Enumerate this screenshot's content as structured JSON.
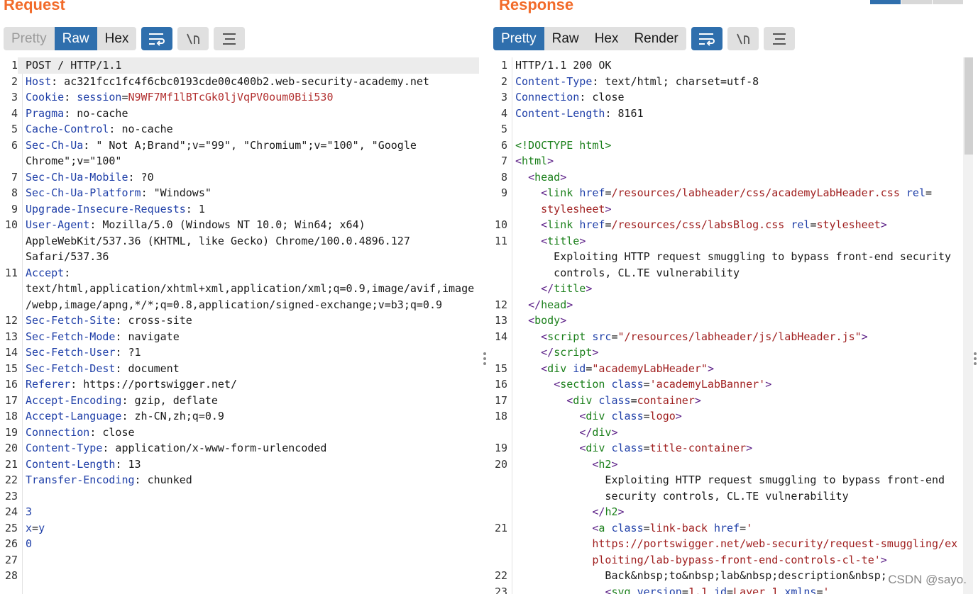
{
  "request": {
    "title": "Request",
    "tabs": [
      "Pretty",
      "Raw",
      "Hex"
    ],
    "active_tab": "Raw",
    "lines": [
      {
        "n": "1",
        "parts": [
          [
            "v",
            "POST / HTTP/1.1"
          ]
        ]
      },
      {
        "n": "2",
        "parts": [
          [
            "k",
            "Host"
          ],
          [
            "v",
            ": ac321fcc1fc4f6cbc0193cde00c400b2.web-security-academy.net"
          ]
        ]
      },
      {
        "n": "3",
        "parts": [
          [
            "k",
            "Cookie"
          ],
          [
            "v",
            ": "
          ],
          [
            "blu",
            "session"
          ],
          [
            "v",
            "="
          ],
          [
            "red",
            "N9WF7Mf1lBTcGk0ljVqPV0oum0Bii530"
          ]
        ]
      },
      {
        "n": "4",
        "parts": [
          [
            "k",
            "Pragma"
          ],
          [
            "v",
            ": no-cache"
          ]
        ]
      },
      {
        "n": "5",
        "parts": [
          [
            "k",
            "Cache-Control"
          ],
          [
            "v",
            ": no-cache"
          ]
        ]
      },
      {
        "n": "6",
        "parts": [
          [
            "k",
            "Sec-Ch-Ua"
          ],
          [
            "v",
            ": \" Not A;Brand\";v=\"99\", \"Chromium\";v=\"100\", \"Google"
          ]
        ]
      },
      {
        "n": "",
        "parts": [
          [
            "v",
            "Chrome\";v=\"100\""
          ]
        ]
      },
      {
        "n": "7",
        "parts": [
          [
            "k",
            "Sec-Ch-Ua-Mobile"
          ],
          [
            "v",
            ": ?0"
          ]
        ]
      },
      {
        "n": "8",
        "parts": [
          [
            "k",
            "Sec-Ch-Ua-Platform"
          ],
          [
            "v",
            ": \"Windows\""
          ]
        ]
      },
      {
        "n": "9",
        "parts": [
          [
            "k",
            "Upgrade-Insecure-Requests"
          ],
          [
            "v",
            ": 1"
          ]
        ]
      },
      {
        "n": "10",
        "parts": [
          [
            "k",
            "User-Agent"
          ],
          [
            "v",
            ": Mozilla/5.0 (Windows NT 10.0; Win64; x64)"
          ]
        ]
      },
      {
        "n": "",
        "parts": [
          [
            "v",
            "AppleWebKit/537.36 (KHTML, like Gecko) Chrome/100.0.4896.127"
          ]
        ]
      },
      {
        "n": "",
        "parts": [
          [
            "v",
            "Safari/537.36"
          ]
        ]
      },
      {
        "n": "11",
        "parts": [
          [
            "k",
            "Accept"
          ],
          [
            "v",
            ":"
          ]
        ]
      },
      {
        "n": "",
        "parts": [
          [
            "v",
            "text/html,application/xhtml+xml,application/xml;q=0.9,image/avif,image"
          ]
        ]
      },
      {
        "n": "",
        "parts": [
          [
            "v",
            "/webp,image/apng,*/*;q=0.8,application/signed-exchange;v=b3;q=0.9"
          ]
        ]
      },
      {
        "n": "12",
        "parts": [
          [
            "k",
            "Sec-Fetch-Site"
          ],
          [
            "v",
            ": cross-site"
          ]
        ]
      },
      {
        "n": "13",
        "parts": [
          [
            "k",
            "Sec-Fetch-Mode"
          ],
          [
            "v",
            ": navigate"
          ]
        ]
      },
      {
        "n": "14",
        "parts": [
          [
            "k",
            "Sec-Fetch-User"
          ],
          [
            "v",
            ": ?1"
          ]
        ]
      },
      {
        "n": "15",
        "parts": [
          [
            "k",
            "Sec-Fetch-Dest"
          ],
          [
            "v",
            ": document"
          ]
        ]
      },
      {
        "n": "16",
        "parts": [
          [
            "k",
            "Referer"
          ],
          [
            "v",
            ": https://portswigger.net/"
          ]
        ]
      },
      {
        "n": "17",
        "parts": [
          [
            "k",
            "Accept-Encoding"
          ],
          [
            "v",
            ": gzip, deflate"
          ]
        ]
      },
      {
        "n": "18",
        "parts": [
          [
            "k",
            "Accept-Language"
          ],
          [
            "v",
            ": zh-CN,zh;q=0.9"
          ]
        ]
      },
      {
        "n": "19",
        "parts": [
          [
            "k",
            "Connection"
          ],
          [
            "v",
            ": close"
          ]
        ]
      },
      {
        "n": "20",
        "parts": [
          [
            "k",
            "Content-Type"
          ],
          [
            "v",
            ": application/x-www-form-urlencoded"
          ]
        ]
      },
      {
        "n": "21",
        "parts": [
          [
            "k",
            "Content-Length"
          ],
          [
            "v",
            ": 13"
          ]
        ]
      },
      {
        "n": "22",
        "parts": [
          [
            "k",
            "Transfer-Encoding"
          ],
          [
            "v",
            ": chunked"
          ]
        ]
      },
      {
        "n": "23",
        "parts": [
          [
            "v",
            ""
          ]
        ]
      },
      {
        "n": "24",
        "parts": [
          [
            "num",
            "3"
          ]
        ]
      },
      {
        "n": "25",
        "parts": [
          [
            "blu",
            "x"
          ],
          [
            "v",
            "="
          ],
          [
            "blu",
            "y"
          ]
        ]
      },
      {
        "n": "26",
        "parts": [
          [
            "num",
            "0"
          ]
        ]
      },
      {
        "n": "27",
        "parts": [
          [
            "v",
            ""
          ]
        ]
      },
      {
        "n": "28",
        "parts": [
          [
            "v",
            ""
          ]
        ]
      }
    ]
  },
  "response": {
    "title": "Response",
    "tabs": [
      "Pretty",
      "Raw",
      "Hex",
      "Render"
    ],
    "active_tab": "Pretty",
    "lines": [
      {
        "n": "1",
        "parts": [
          [
            "v",
            "HTTP/1.1 200 OK"
          ]
        ]
      },
      {
        "n": "2",
        "parts": [
          [
            "k",
            "Content-Type"
          ],
          [
            "v",
            ": text/html; charset=utf-8"
          ]
        ]
      },
      {
        "n": "3",
        "parts": [
          [
            "k",
            "Connection"
          ],
          [
            "v",
            ": close"
          ]
        ]
      },
      {
        "n": "4",
        "parts": [
          [
            "k",
            "Content-Length"
          ],
          [
            "v",
            ": 8161"
          ]
        ]
      },
      {
        "n": "5",
        "parts": [
          [
            "v",
            ""
          ]
        ]
      },
      {
        "n": "6",
        "parts": [
          [
            "tg",
            "<!DOCTYPE html>"
          ]
        ]
      },
      {
        "n": "7",
        "parts": [
          [
            "tag",
            "<"
          ],
          [
            "tg",
            "html"
          ],
          [
            "tag",
            ">"
          ]
        ]
      },
      {
        "n": "8",
        "parts": [
          [
            "v",
            "  "
          ],
          [
            "tag",
            "<"
          ],
          [
            "tg",
            "head"
          ],
          [
            "tag",
            ">"
          ]
        ]
      },
      {
        "n": "9",
        "parts": [
          [
            "v",
            "    "
          ],
          [
            "tag",
            "<"
          ],
          [
            "tg",
            "link"
          ],
          [
            "v",
            " "
          ],
          [
            "at",
            "href"
          ],
          [
            "v",
            "="
          ],
          [
            "st",
            "/resources/labheader/css/academyLabHeader.css"
          ],
          [
            "v",
            " "
          ],
          [
            "at",
            "rel"
          ],
          [
            "v",
            "="
          ]
        ]
      },
      {
        "n": "",
        "parts": [
          [
            "v",
            "    "
          ],
          [
            "st",
            "stylesheet"
          ],
          [
            "tag",
            ">"
          ]
        ]
      },
      {
        "n": "10",
        "parts": [
          [
            "v",
            "    "
          ],
          [
            "tag",
            "<"
          ],
          [
            "tg",
            "link"
          ],
          [
            "v",
            " "
          ],
          [
            "at",
            "href"
          ],
          [
            "v",
            "="
          ],
          [
            "st",
            "/resources/css/labsBlog.css"
          ],
          [
            "v",
            " "
          ],
          [
            "at",
            "rel"
          ],
          [
            "v",
            "="
          ],
          [
            "st",
            "stylesheet"
          ],
          [
            "tag",
            ">"
          ]
        ]
      },
      {
        "n": "11",
        "parts": [
          [
            "v",
            "    "
          ],
          [
            "tag",
            "<"
          ],
          [
            "tg",
            "title"
          ],
          [
            "tag",
            ">"
          ]
        ]
      },
      {
        "n": "",
        "parts": [
          [
            "v",
            "      Exploiting HTTP request smuggling to bypass front-end security"
          ]
        ]
      },
      {
        "n": "",
        "parts": [
          [
            "v",
            "      controls, CL.TE vulnerability"
          ]
        ]
      },
      {
        "n": "",
        "parts": [
          [
            "v",
            "    "
          ],
          [
            "tag",
            "</"
          ],
          [
            "tg",
            "title"
          ],
          [
            "tag",
            ">"
          ]
        ]
      },
      {
        "n": "12",
        "parts": [
          [
            "v",
            "  "
          ],
          [
            "tag",
            "</"
          ],
          [
            "tg",
            "head"
          ],
          [
            "tag",
            ">"
          ]
        ]
      },
      {
        "n": "13",
        "parts": [
          [
            "v",
            "  "
          ],
          [
            "tag",
            "<"
          ],
          [
            "tg",
            "body"
          ],
          [
            "tag",
            ">"
          ]
        ]
      },
      {
        "n": "14",
        "parts": [
          [
            "v",
            "    "
          ],
          [
            "tag",
            "<"
          ],
          [
            "tg",
            "script"
          ],
          [
            "v",
            " "
          ],
          [
            "at",
            "src"
          ],
          [
            "v",
            "="
          ],
          [
            "st",
            "\"/resources/labheader/js/labHeader.js\""
          ],
          [
            "tag",
            ">"
          ]
        ]
      },
      {
        "n": "",
        "parts": [
          [
            "v",
            "    "
          ],
          [
            "tag",
            "</"
          ],
          [
            "tg",
            "script"
          ],
          [
            "tag",
            ">"
          ]
        ]
      },
      {
        "n": "15",
        "parts": [
          [
            "v",
            "    "
          ],
          [
            "tag",
            "<"
          ],
          [
            "tg",
            "div"
          ],
          [
            "v",
            " "
          ],
          [
            "at",
            "id"
          ],
          [
            "v",
            "="
          ],
          [
            "st",
            "\"academyLabHeader\""
          ],
          [
            "tag",
            ">"
          ]
        ]
      },
      {
        "n": "16",
        "parts": [
          [
            "v",
            "      "
          ],
          [
            "tag",
            "<"
          ],
          [
            "tg",
            "section"
          ],
          [
            "v",
            " "
          ],
          [
            "at",
            "class"
          ],
          [
            "v",
            "="
          ],
          [
            "st",
            "'academyLabBanner'"
          ],
          [
            "tag",
            ">"
          ]
        ]
      },
      {
        "n": "17",
        "parts": [
          [
            "v",
            "        "
          ],
          [
            "tag",
            "<"
          ],
          [
            "tg",
            "div"
          ],
          [
            "v",
            " "
          ],
          [
            "at",
            "class"
          ],
          [
            "v",
            "="
          ],
          [
            "st",
            "container"
          ],
          [
            "tag",
            ">"
          ]
        ]
      },
      {
        "n": "18",
        "parts": [
          [
            "v",
            "          "
          ],
          [
            "tag",
            "<"
          ],
          [
            "tg",
            "div"
          ],
          [
            "v",
            " "
          ],
          [
            "at",
            "class"
          ],
          [
            "v",
            "="
          ],
          [
            "st",
            "logo"
          ],
          [
            "tag",
            ">"
          ]
        ]
      },
      {
        "n": "",
        "parts": [
          [
            "v",
            "          "
          ],
          [
            "tag",
            "</"
          ],
          [
            "tg",
            "div"
          ],
          [
            "tag",
            ">"
          ]
        ]
      },
      {
        "n": "19",
        "parts": [
          [
            "v",
            "          "
          ],
          [
            "tag",
            "<"
          ],
          [
            "tg",
            "div"
          ],
          [
            "v",
            " "
          ],
          [
            "at",
            "class"
          ],
          [
            "v",
            "="
          ],
          [
            "st",
            "title-container"
          ],
          [
            "tag",
            ">"
          ]
        ]
      },
      {
        "n": "20",
        "parts": [
          [
            "v",
            "            "
          ],
          [
            "tag",
            "<"
          ],
          [
            "tg",
            "h2"
          ],
          [
            "tag",
            ">"
          ]
        ]
      },
      {
        "n": "",
        "parts": [
          [
            "v",
            "              Exploiting HTTP request smuggling to bypass front-end"
          ]
        ]
      },
      {
        "n": "",
        "parts": [
          [
            "v",
            "              security controls, CL.TE vulnerability"
          ]
        ]
      },
      {
        "n": "",
        "parts": [
          [
            "v",
            "            "
          ],
          [
            "tag",
            "</"
          ],
          [
            "tg",
            "h2"
          ],
          [
            "tag",
            ">"
          ]
        ]
      },
      {
        "n": "21",
        "parts": [
          [
            "v",
            "            "
          ],
          [
            "tag",
            "<"
          ],
          [
            "tg",
            "a"
          ],
          [
            "v",
            " "
          ],
          [
            "at",
            "class"
          ],
          [
            "v",
            "="
          ],
          [
            "st",
            "link-back"
          ],
          [
            "v",
            " "
          ],
          [
            "at",
            "href"
          ],
          [
            "v",
            "="
          ],
          [
            "st",
            "'"
          ]
        ]
      },
      {
        "n": "",
        "parts": [
          [
            "v",
            "            "
          ],
          [
            "st",
            "https://portswigger.net/web-security/request-smuggling/ex"
          ]
        ]
      },
      {
        "n": "",
        "parts": [
          [
            "v",
            "            "
          ],
          [
            "st",
            "ploiting/lab-bypass-front-end-controls-cl-te'"
          ],
          [
            "tag",
            ">"
          ]
        ]
      },
      {
        "n": "22",
        "parts": [
          [
            "v",
            "              Back&nbsp;to&nbsp;lab&nbsp;description&nbsp;"
          ]
        ]
      },
      {
        "n": "23",
        "parts": [
          [
            "v",
            "              "
          ],
          [
            "tag",
            "<"
          ],
          [
            "tg",
            "svg"
          ],
          [
            "v",
            " "
          ],
          [
            "at",
            "version"
          ],
          [
            "v",
            "="
          ],
          [
            "st",
            "1.1"
          ],
          [
            "v",
            " "
          ],
          [
            "at",
            "id"
          ],
          [
            "v",
            "="
          ],
          [
            "st",
            "Layer_1"
          ],
          [
            "v",
            " "
          ],
          [
            "at",
            "xmlns"
          ],
          [
            "v",
            "="
          ],
          [
            "st",
            "'"
          ]
        ]
      }
    ]
  },
  "watermark": "CSDN @sayo."
}
